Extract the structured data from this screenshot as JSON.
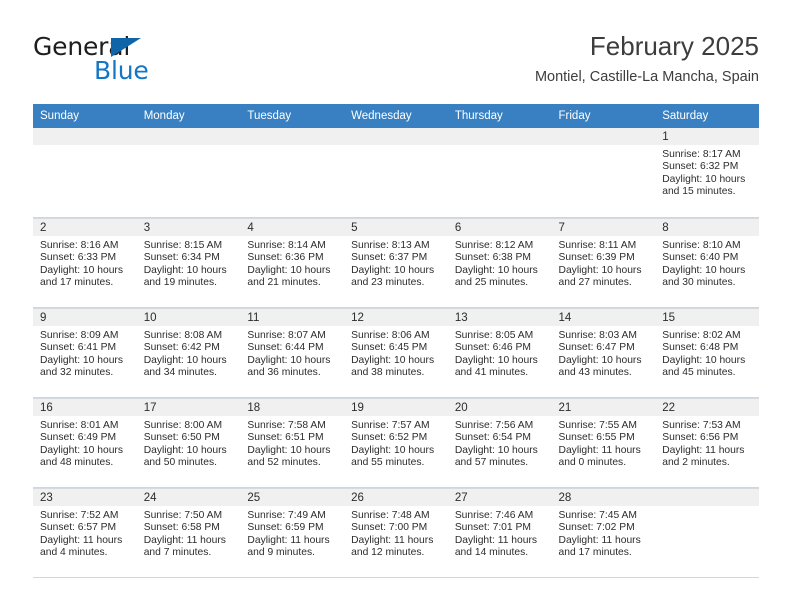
{
  "brand": {
    "name_part1": "General",
    "name_part2": "Blue"
  },
  "header": {
    "title": "February 2025",
    "subtitle": "Montiel, Castille-La Mancha, Spain"
  },
  "colors": {
    "header_blue": "#3880c2",
    "brand_blue": "#1477c4",
    "daynum_band": "#f0f0f0",
    "grid_line": "#cfd6dd"
  },
  "weekdays": [
    "Sunday",
    "Monday",
    "Tuesday",
    "Wednesday",
    "Thursday",
    "Friday",
    "Saturday"
  ],
  "weeks": [
    [
      {
        "day": "",
        "sunrise": "",
        "sunset": "",
        "daylight_line1": "",
        "daylight_line2": ""
      },
      {
        "day": "",
        "sunrise": "",
        "sunset": "",
        "daylight_line1": "",
        "daylight_line2": ""
      },
      {
        "day": "",
        "sunrise": "",
        "sunset": "",
        "daylight_line1": "",
        "daylight_line2": ""
      },
      {
        "day": "",
        "sunrise": "",
        "sunset": "",
        "daylight_line1": "",
        "daylight_line2": ""
      },
      {
        "day": "",
        "sunrise": "",
        "sunset": "",
        "daylight_line1": "",
        "daylight_line2": ""
      },
      {
        "day": "",
        "sunrise": "",
        "sunset": "",
        "daylight_line1": "",
        "daylight_line2": ""
      },
      {
        "day": "1",
        "sunrise": "Sunrise: 8:17 AM",
        "sunset": "Sunset: 6:32 PM",
        "daylight_line1": "Daylight: 10 hours",
        "daylight_line2": "and 15 minutes."
      }
    ],
    [
      {
        "day": "2",
        "sunrise": "Sunrise: 8:16 AM",
        "sunset": "Sunset: 6:33 PM",
        "daylight_line1": "Daylight: 10 hours",
        "daylight_line2": "and 17 minutes."
      },
      {
        "day": "3",
        "sunrise": "Sunrise: 8:15 AM",
        "sunset": "Sunset: 6:34 PM",
        "daylight_line1": "Daylight: 10 hours",
        "daylight_line2": "and 19 minutes."
      },
      {
        "day": "4",
        "sunrise": "Sunrise: 8:14 AM",
        "sunset": "Sunset: 6:36 PM",
        "daylight_line1": "Daylight: 10 hours",
        "daylight_line2": "and 21 minutes."
      },
      {
        "day": "5",
        "sunrise": "Sunrise: 8:13 AM",
        "sunset": "Sunset: 6:37 PM",
        "daylight_line1": "Daylight: 10 hours",
        "daylight_line2": "and 23 minutes."
      },
      {
        "day": "6",
        "sunrise": "Sunrise: 8:12 AM",
        "sunset": "Sunset: 6:38 PM",
        "daylight_line1": "Daylight: 10 hours",
        "daylight_line2": "and 25 minutes."
      },
      {
        "day": "7",
        "sunrise": "Sunrise: 8:11 AM",
        "sunset": "Sunset: 6:39 PM",
        "daylight_line1": "Daylight: 10 hours",
        "daylight_line2": "and 27 minutes."
      },
      {
        "day": "8",
        "sunrise": "Sunrise: 8:10 AM",
        "sunset": "Sunset: 6:40 PM",
        "daylight_line1": "Daylight: 10 hours",
        "daylight_line2": "and 30 minutes."
      }
    ],
    [
      {
        "day": "9",
        "sunrise": "Sunrise: 8:09 AM",
        "sunset": "Sunset: 6:41 PM",
        "daylight_line1": "Daylight: 10 hours",
        "daylight_line2": "and 32 minutes."
      },
      {
        "day": "10",
        "sunrise": "Sunrise: 8:08 AM",
        "sunset": "Sunset: 6:42 PM",
        "daylight_line1": "Daylight: 10 hours",
        "daylight_line2": "and 34 minutes."
      },
      {
        "day": "11",
        "sunrise": "Sunrise: 8:07 AM",
        "sunset": "Sunset: 6:44 PM",
        "daylight_line1": "Daylight: 10 hours",
        "daylight_line2": "and 36 minutes."
      },
      {
        "day": "12",
        "sunrise": "Sunrise: 8:06 AM",
        "sunset": "Sunset: 6:45 PM",
        "daylight_line1": "Daylight: 10 hours",
        "daylight_line2": "and 38 minutes."
      },
      {
        "day": "13",
        "sunrise": "Sunrise: 8:05 AM",
        "sunset": "Sunset: 6:46 PM",
        "daylight_line1": "Daylight: 10 hours",
        "daylight_line2": "and 41 minutes."
      },
      {
        "day": "14",
        "sunrise": "Sunrise: 8:03 AM",
        "sunset": "Sunset: 6:47 PM",
        "daylight_line1": "Daylight: 10 hours",
        "daylight_line2": "and 43 minutes."
      },
      {
        "day": "15",
        "sunrise": "Sunrise: 8:02 AM",
        "sunset": "Sunset: 6:48 PM",
        "daylight_line1": "Daylight: 10 hours",
        "daylight_line2": "and 45 minutes."
      }
    ],
    [
      {
        "day": "16",
        "sunrise": "Sunrise: 8:01 AM",
        "sunset": "Sunset: 6:49 PM",
        "daylight_line1": "Daylight: 10 hours",
        "daylight_line2": "and 48 minutes."
      },
      {
        "day": "17",
        "sunrise": "Sunrise: 8:00 AM",
        "sunset": "Sunset: 6:50 PM",
        "daylight_line1": "Daylight: 10 hours",
        "daylight_line2": "and 50 minutes."
      },
      {
        "day": "18",
        "sunrise": "Sunrise: 7:58 AM",
        "sunset": "Sunset: 6:51 PM",
        "daylight_line1": "Daylight: 10 hours",
        "daylight_line2": "and 52 minutes."
      },
      {
        "day": "19",
        "sunrise": "Sunrise: 7:57 AM",
        "sunset": "Sunset: 6:52 PM",
        "daylight_line1": "Daylight: 10 hours",
        "daylight_line2": "and 55 minutes."
      },
      {
        "day": "20",
        "sunrise": "Sunrise: 7:56 AM",
        "sunset": "Sunset: 6:54 PM",
        "daylight_line1": "Daylight: 10 hours",
        "daylight_line2": "and 57 minutes."
      },
      {
        "day": "21",
        "sunrise": "Sunrise: 7:55 AM",
        "sunset": "Sunset: 6:55 PM",
        "daylight_line1": "Daylight: 11 hours",
        "daylight_line2": "and 0 minutes."
      },
      {
        "day": "22",
        "sunrise": "Sunrise: 7:53 AM",
        "sunset": "Sunset: 6:56 PM",
        "daylight_line1": "Daylight: 11 hours",
        "daylight_line2": "and 2 minutes."
      }
    ],
    [
      {
        "day": "23",
        "sunrise": "Sunrise: 7:52 AM",
        "sunset": "Sunset: 6:57 PM",
        "daylight_line1": "Daylight: 11 hours",
        "daylight_line2": "and 4 minutes."
      },
      {
        "day": "24",
        "sunrise": "Sunrise: 7:50 AM",
        "sunset": "Sunset: 6:58 PM",
        "daylight_line1": "Daylight: 11 hours",
        "daylight_line2": "and 7 minutes."
      },
      {
        "day": "25",
        "sunrise": "Sunrise: 7:49 AM",
        "sunset": "Sunset: 6:59 PM",
        "daylight_line1": "Daylight: 11 hours",
        "daylight_line2": "and 9 minutes."
      },
      {
        "day": "26",
        "sunrise": "Sunrise: 7:48 AM",
        "sunset": "Sunset: 7:00 PM",
        "daylight_line1": "Daylight: 11 hours",
        "daylight_line2": "and 12 minutes."
      },
      {
        "day": "27",
        "sunrise": "Sunrise: 7:46 AM",
        "sunset": "Sunset: 7:01 PM",
        "daylight_line1": "Daylight: 11 hours",
        "daylight_line2": "and 14 minutes."
      },
      {
        "day": "28",
        "sunrise": "Sunrise: 7:45 AM",
        "sunset": "Sunset: 7:02 PM",
        "daylight_line1": "Daylight: 11 hours",
        "daylight_line2": "and 17 minutes."
      },
      {
        "day": "",
        "sunrise": "",
        "sunset": "",
        "daylight_line1": "",
        "daylight_line2": ""
      }
    ]
  ]
}
